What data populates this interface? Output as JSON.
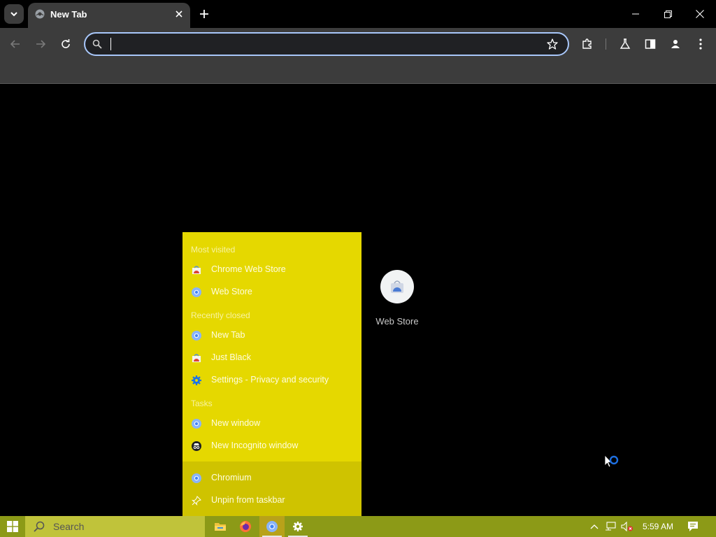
{
  "browser": {
    "tab": {
      "title": "New Tab"
    },
    "omnibox": {
      "value": "",
      "placeholder": ""
    }
  },
  "page": {
    "tiles": [
      {
        "label": "Web Store"
      }
    ]
  },
  "jumplist": {
    "most_visited_header": "Most visited",
    "most_visited": [
      {
        "label": "Chrome Web Store",
        "icon": "webstore-icon"
      },
      {
        "label": "Web Store",
        "icon": "chromium-icon"
      }
    ],
    "recently_closed_header": "Recently closed",
    "recently_closed": [
      {
        "label": "New Tab",
        "icon": "chromium-icon"
      },
      {
        "label": "Just Black",
        "icon": "webstore-icon"
      },
      {
        "label": "Settings - Privacy and security",
        "icon": "gear-icon"
      }
    ],
    "tasks_header": "Tasks",
    "tasks": [
      {
        "label": "New window",
        "icon": "chromium-icon"
      },
      {
        "label": "New Incognito window",
        "icon": "incognito-icon"
      }
    ],
    "footer": [
      {
        "label": "Chromium",
        "icon": "chromium-icon"
      },
      {
        "label": "Unpin from taskbar",
        "icon": "unpin-icon"
      }
    ]
  },
  "taskbar": {
    "search_text": "Search",
    "clock": "5:59 AM"
  },
  "colors": {
    "jumplist_bg": "#e5d800",
    "jumplist_footer_bg": "#cfc300",
    "taskbar_bg": "#8c9a17",
    "omnibox_border": "#a8c7fa",
    "chrome_toolbar": "#3c3c3c"
  }
}
